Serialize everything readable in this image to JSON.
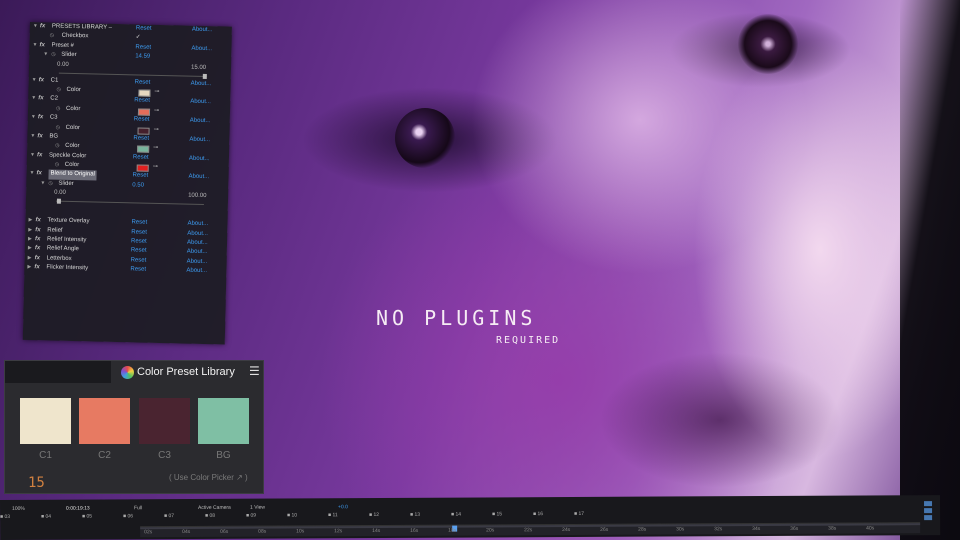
{
  "overlay": {
    "headline": "NO PLUGINS",
    "subline": "REQUIRED"
  },
  "effects_panel": {
    "rows": [
      {
        "kind": "header",
        "name": "PRESETS LIBRARY –",
        "reset": "Reset",
        "about": "About..."
      },
      {
        "kind": "checkbox",
        "name": "Checkbox",
        "check": "✓"
      },
      {
        "kind": "header",
        "name": "Preset #",
        "reset": "Reset",
        "about": "About..."
      },
      {
        "kind": "value",
        "name": "Slider",
        "value": "14.59"
      },
      {
        "kind": "range",
        "lo": "0.00",
        "hi": "15.00",
        "level": 0.97
      },
      {
        "kind": "header",
        "name": "C1",
        "reset": "Reset",
        "about": "About..."
      },
      {
        "kind": "color",
        "name": "Color",
        "swatch": "#e6d8c0"
      },
      {
        "kind": "header",
        "name": "C2",
        "reset": "Reset",
        "about": "About..."
      },
      {
        "kind": "color",
        "name": "Color",
        "swatch": "#e36d5a"
      },
      {
        "kind": "header",
        "name": "C3",
        "reset": "Reset",
        "about": "About..."
      },
      {
        "kind": "color",
        "name": "Color",
        "swatch": "#45202c"
      },
      {
        "kind": "header",
        "name": "BG",
        "reset": "Reset",
        "about": "About..."
      },
      {
        "kind": "color",
        "name": "Color",
        "swatch": "#78b49c"
      },
      {
        "kind": "header",
        "name": "Speckle Color",
        "reset": "Reset",
        "about": "About..."
      },
      {
        "kind": "color",
        "name": "Color",
        "swatch": "#e02020"
      },
      {
        "kind": "header",
        "name": "Blend to Original",
        "reset": "Reset",
        "about": "About...",
        "selected": true
      },
      {
        "kind": "value",
        "name": "Slider",
        "value": "0.50"
      },
      {
        "kind": "range",
        "lo": "0.00",
        "hi": "100.00",
        "level": 0.005
      },
      {
        "kind": "spacer"
      },
      {
        "kind": "collapsed",
        "name": "Texture Overlay",
        "reset": "Reset",
        "about": "About..."
      },
      {
        "kind": "collapsed",
        "name": "Relief",
        "reset": "Reset",
        "about": "About..."
      },
      {
        "kind": "collapsed",
        "name": "Relief Intensity",
        "reset": "Reset",
        "about": "About..."
      },
      {
        "kind": "collapsed",
        "name": "Relief Angle",
        "reset": "Reset",
        "about": "About..."
      },
      {
        "kind": "collapsed",
        "name": "Letterbox",
        "reset": "Reset",
        "about": "About..."
      },
      {
        "kind": "collapsed",
        "name": "Flicker Intensity",
        "reset": "Reset",
        "about": "About..."
      }
    ],
    "fx_label": "fx"
  },
  "color_preset_library": {
    "title": "Color Preset Library",
    "menu": "☰",
    "swatches": [
      {
        "label": "C1",
        "color": "#efe5cc"
      },
      {
        "label": "C2",
        "color": "#e77a62"
      },
      {
        "label": "C3",
        "color": "#4a2430"
      },
      {
        "label": "BG",
        "color": "#7fbfa4"
      }
    ],
    "preset_number": "15",
    "hint": "( Use Color Picker ↗ )"
  },
  "timeline": {
    "zoom": "100%",
    "timecode": "0:00:19:13",
    "resolution": "Full",
    "camera": "Active Camera",
    "views": "1 View",
    "exposure": "+0.0",
    "markers": [
      "03",
      "04",
      "05",
      "06",
      "07",
      "08",
      "09",
      "10",
      "11",
      "12",
      "13",
      "14",
      "15",
      "16",
      "17"
    ],
    "ruler": [
      "02s",
      "04s",
      "06s",
      "08s",
      "10s",
      "12s",
      "14s",
      "16s",
      "18s",
      "20s",
      "22s",
      "24s",
      "26s",
      "28s",
      "30s",
      "32s",
      "34s",
      "36s",
      "38s",
      "40s"
    ]
  },
  "colors": {
    "accent_blue": "#3d9bf0",
    "timecode_orange": "#d08040"
  }
}
